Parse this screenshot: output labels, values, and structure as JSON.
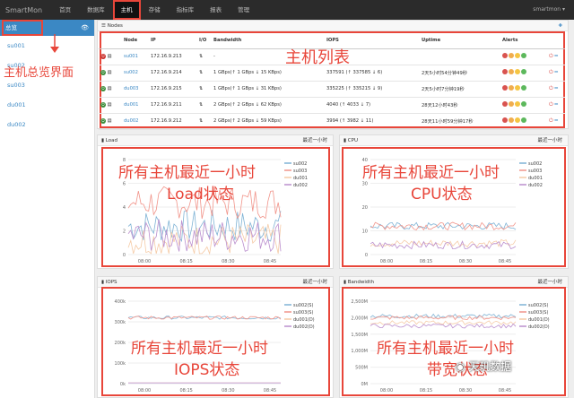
{
  "app": {
    "brand": "SmartMon",
    "user": "smartmon ▾"
  },
  "nav": [
    "首页",
    "数据库",
    "主机",
    "存储",
    "指标库",
    "报表",
    "管理"
  ],
  "sidebar": {
    "header": "总览",
    "items": [
      "su001",
      "su002",
      "su003",
      "du001",
      "du002"
    ]
  },
  "annotations": {
    "overview": "主机总览界面",
    "host_list": "主机列表",
    "load": [
      "所有主机最近一小时",
      "Load状态"
    ],
    "cpu": [
      "所有主机最近一小时",
      "CPU状态"
    ],
    "iops": [
      "所有主机最近一小时",
      "IOPS状态"
    ],
    "bw": [
      "所有主机最近一小时",
      "带宽状态"
    ]
  },
  "nodes_panel": {
    "title": "Nodes",
    "columns": [
      "Node",
      "IP",
      "I/O",
      "Bandwidth",
      "IOPS",
      "Uptime",
      "Alerts"
    ],
    "rows": [
      {
        "node": "su001",
        "ip": "172.16.9.213",
        "bw": "-",
        "iops": "",
        "uptime": "",
        "alerts": [
          "0",
          "0",
          "0",
          "0"
        ]
      },
      {
        "node": "su002",
        "ip": "172.16.9.214",
        "bw": "1 GBps(↑ 1 GBps ↓ 15 KBps)",
        "iops": "337591 (↑ 337585 ↓ 6)",
        "uptime": "2天5小时54分钟49秒",
        "alerts": [
          "0",
          "0",
          "0",
          "0"
        ]
      },
      {
        "node": "du003",
        "ip": "172.16.9.215",
        "bw": "1 GBps(↑ 1 GBps ↓ 31 KBps)",
        "iops": "335225 (↑ 335215 ↓ 9)",
        "uptime": "2天5小时7分钟19秒",
        "alerts": [
          "0",
          "0",
          "0",
          "0"
        ]
      },
      {
        "node": "du001",
        "ip": "172.16.9.211",
        "bw": "2 GBps(↑ 2 GBps ↓ 62 KBps)",
        "iops": "4040 (↑ 4033 ↓ 7)",
        "uptime": "28天12小时43秒",
        "alerts": [
          "0",
          "0",
          "0",
          "0"
        ]
      },
      {
        "node": "du002",
        "ip": "172.16.9.212",
        "bw": "2 GBps(↑ 2 GBps ↓ 59 KBps)",
        "iops": "3994 (↑ 3982 ↓ 11)",
        "uptime": "28天11小时59分钟17秒",
        "alerts": [
          "0",
          "0",
          "0",
          "0"
        ]
      }
    ]
  },
  "range_label": "最近一小时",
  "chart_data": [
    {
      "type": "line",
      "title": "Load",
      "x": [
        "08:00",
        "08:15",
        "08:30",
        "08:45"
      ],
      "ylim": [
        0,
        8
      ],
      "yticks": [
        "0",
        "2",
        "4",
        "6",
        "8"
      ],
      "series": [
        {
          "name": "su002",
          "color": "#7fb3d5"
        },
        {
          "name": "su003",
          "color": "#f1948a"
        },
        {
          "name": "du001",
          "color": "#f5cba7"
        },
        {
          "name": "du002",
          "color": "#bb8fce"
        }
      ]
    },
    {
      "type": "line",
      "title": "CPU",
      "x": [
        "08:00",
        "08:15",
        "08:30",
        "08:45"
      ],
      "ylim": [
        0,
        40
      ],
      "yticks": [
        "0",
        "10",
        "20",
        "30",
        "40"
      ],
      "series": [
        {
          "name": "su002",
          "color": "#7fb3d5"
        },
        {
          "name": "su003",
          "color": "#f1948a"
        },
        {
          "name": "du001",
          "color": "#f5cba7"
        },
        {
          "name": "du002",
          "color": "#bb8fce"
        }
      ]
    },
    {
      "type": "line",
      "title": "IOPS",
      "x": [
        "08:00",
        "08:15",
        "08:30",
        "08:45"
      ],
      "ylim": [
        0,
        400
      ],
      "yticks": [
        "0k",
        "100k",
        "200k",
        "300k",
        "400k"
      ],
      "series": [
        {
          "name": "su002(S)",
          "color": "#7fb3d5"
        },
        {
          "name": "su003(S)",
          "color": "#f1948a"
        },
        {
          "name": "du001(D)",
          "color": "#f5cba7"
        },
        {
          "name": "du002(D)",
          "color": "#bb8fce"
        }
      ]
    },
    {
      "type": "line",
      "title": "Bandwidth",
      "x": [
        "08:00",
        "08:15",
        "08:30",
        "08:45"
      ],
      "ylim": [
        0,
        2500
      ],
      "yticks": [
        "0M",
        "500M",
        "1,000M",
        "1,500M",
        "2,000M",
        "2,500M"
      ],
      "series": [
        {
          "name": "su002(S)",
          "color": "#7fb3d5"
        },
        {
          "name": "su003(S)",
          "color": "#f1948a"
        },
        {
          "name": "du001(D)",
          "color": "#f5cba7"
        },
        {
          "name": "du002(D)",
          "color": "#bb8fce"
        }
      ]
    }
  ],
  "watermark": "天玑数据"
}
